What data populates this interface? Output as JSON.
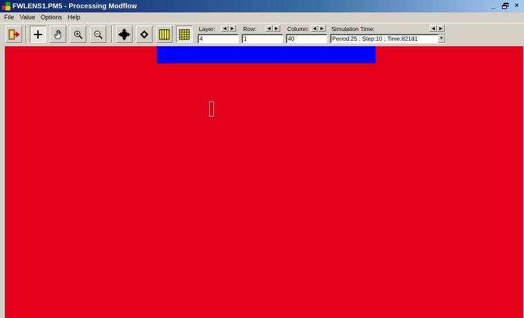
{
  "window": {
    "title": "FWLENS1.PM5 - Processing Modflow",
    "minimize_label": "_",
    "restore_label": "🗗",
    "close_label": "×"
  },
  "menu": {
    "items": [
      {
        "label": "File"
      },
      {
        "label": "Value"
      },
      {
        "label": "Options"
      },
      {
        "label": "Help"
      }
    ]
  },
  "toolbar": {
    "layer": {
      "label": "Layer:",
      "value": "4"
    },
    "row": {
      "label": "Row:",
      "value": "1"
    },
    "column": {
      "label": "Column:",
      "value": "40"
    },
    "simulation_time": {
      "label": "Simulation Time:",
      "value": "Period:25 ; Step:10 ; Time:82181"
    },
    "icons": [
      "exit-icon",
      "crosshair-icon",
      "hand-icon",
      "zoom-in-icon",
      "zoom-out-icon",
      "move-icon",
      "small-move-icon",
      "grid-yellow-icon",
      "grid-table-icon"
    ]
  },
  "colors": {
    "canvas_red": "#e3001b",
    "band_blue": "#0000ff",
    "titlebar_start": "#0a246a",
    "face": "#d4d0c8"
  }
}
